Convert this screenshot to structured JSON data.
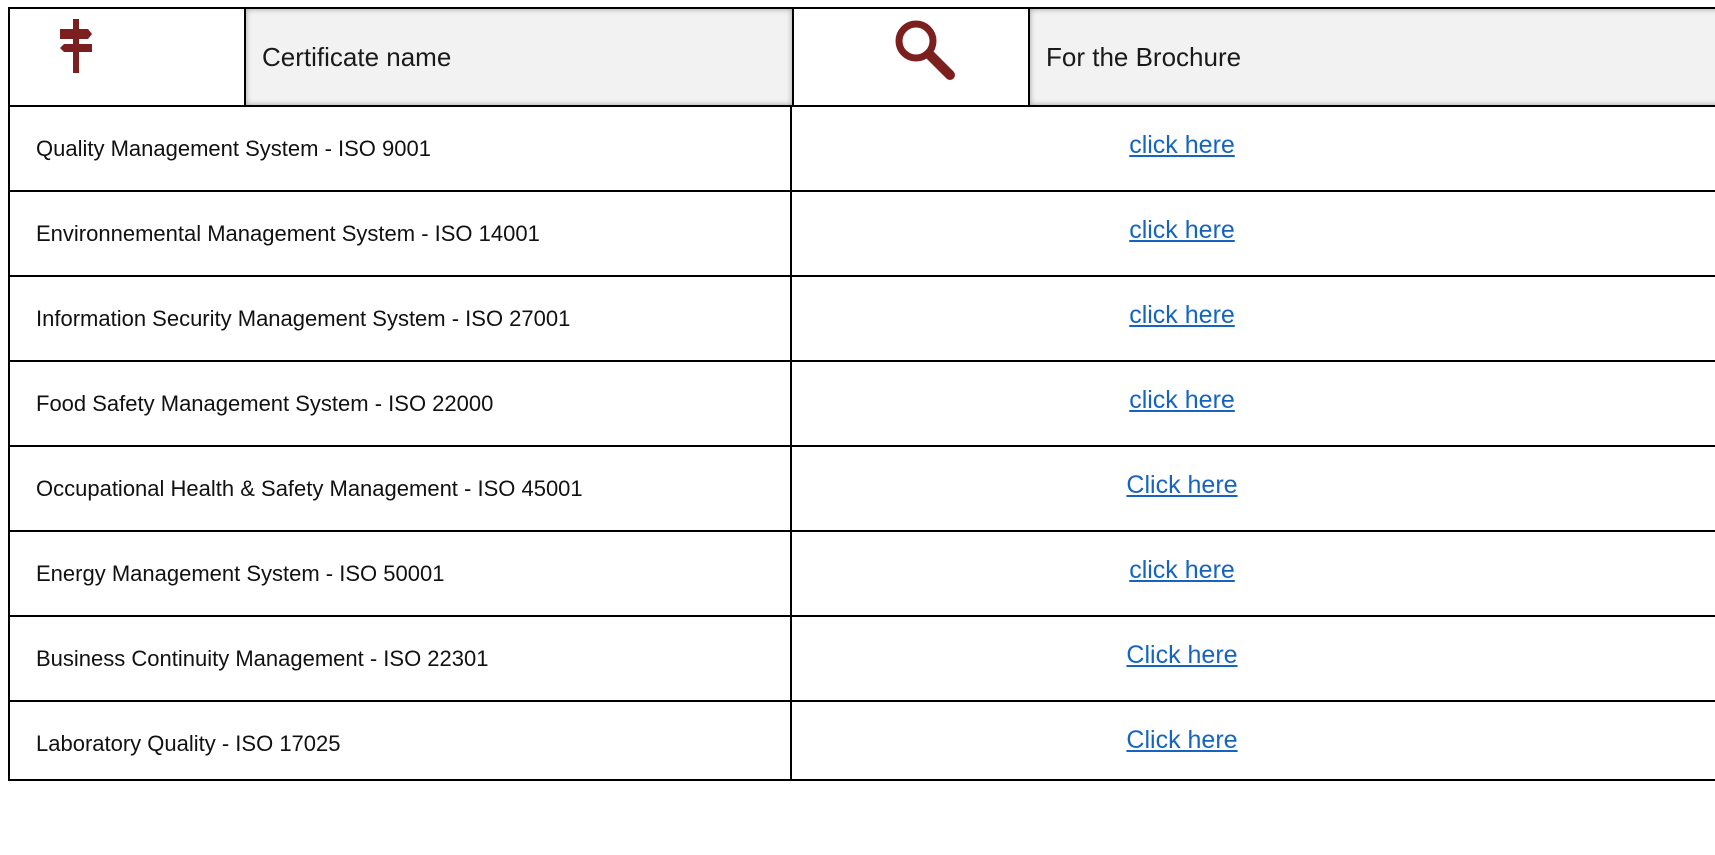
{
  "header": {
    "column1_label": "Certificate name",
    "column2_label": "For the Brochure",
    "signpost_icon": "signpost-icon",
    "magnifier_icon": "magnifier-icon",
    "icon_color": "#7b1f1f"
  },
  "rows": [
    {
      "name": "Quality Management System - ISO 9001",
      "link": "click here"
    },
    {
      "name": "Environnemental Management System - ISO 14001",
      "link": "click here"
    },
    {
      "name": "Information Security Management System - ISO 27001",
      "link": "click here"
    },
    {
      "name": "Food Safety Management System - ISO 22000",
      "link": "click here"
    },
    {
      "name": "Occupational Health & Safety Management - ISO 45001",
      "link": "Click here"
    },
    {
      "name": "Energy Management System - ISO 50001",
      "link": "click here"
    },
    {
      "name": "Business Continuity Management - ISO 22301",
      "link": "Click here"
    },
    {
      "name": "Laboratory Quality - ISO 17025",
      "link": "Click here"
    }
  ]
}
